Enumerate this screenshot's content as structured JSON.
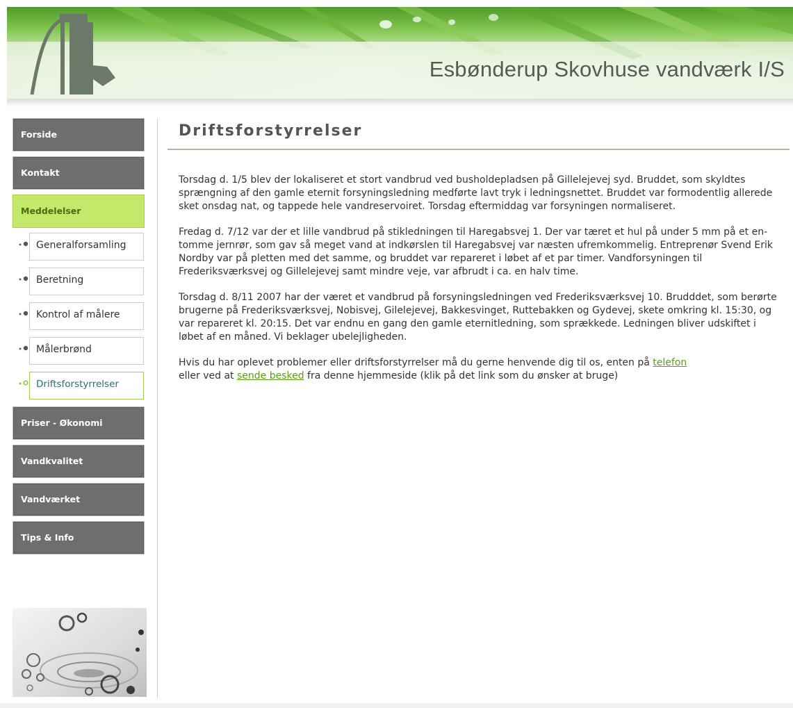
{
  "header": {
    "site_title": "Esbønderup Skovhuse vandværk I/S",
    "logo_icon": "water-pump-icon"
  },
  "nav": {
    "items_top": [
      {
        "label": "Forside"
      },
      {
        "label": "Kontakt"
      },
      {
        "label": "Meddelelser",
        "active": true
      }
    ],
    "sub_items": [
      {
        "label": "Generalforsamling"
      },
      {
        "label": "Beretning"
      },
      {
        "label": "Kontrol af målere"
      },
      {
        "label": "Målerbrønd"
      },
      {
        "label": "Driftsforstyrrelser",
        "current": true
      }
    ],
    "items_bottom": [
      {
        "label": "Priser - Økonomi"
      },
      {
        "label": "Vandkvalitet"
      },
      {
        "label": "Vandværket"
      },
      {
        "label": "Tips & Info"
      }
    ]
  },
  "main": {
    "title": "Driftsforstyrrelser",
    "paragraphs": [
      "Torsdag d. 1/5 blev der lokaliseret et stort vandbrud ved busholdepladsen på Gillelejevej syd. Bruddet, som skyldtes sprængning af den gamle eternit forsyningsledning medførte lavt tryk i ledningsnettet. Bruddet var formodentlig allerede sket onsdag nat, og tappede hele vandreservoiret. Torsdag eftermiddag var forsyningen normaliseret.",
      "Fredag d. 7/12 var der et lille vandbrud på stikledningen til Haregabsvej 1. Der var tæret et hul på under 5 mm på et en-tomme jernrør, som gav så meget vand at indkørslen til Haregabsvej var næsten ufremkommelig. Entreprenør Svend Erik Nordby var på pletten med det samme, og bruddet var repareret i løbet af et par timer. Vandforsyningen til Frederiksværksvej og Gillelejevej samt mindre veje, var afbrudt i ca. en halv time.",
      "Torsdag d. 8/11 2007 har der været et vandbrud på forsyningsledningen ved Frederiksværksvej 10. Brudddet, som berørte brugerne på Frederiksværksvej, Nobisvej, Gilelejevej, Bakkesvinget, Ruttebakken og Gydevej, skete omkring kl. 15:30, og var repareret kl. 20:15. Det var endnu en gang den gamle eternitledning, som sprækkede. Ledningen bliver udskiftet i løbet af en måned. Vi beklager ubelejligheden."
    ],
    "contact": {
      "part1": "Hvis du har oplevet problemer eller driftsforstyrrelser må du gerne henvende dig til os, enten på ",
      "link1": "telefon",
      "part2": " eller ved at ",
      "link2": "sende besked",
      "part3": " fra denne hjemmeside (klik på det link som du ønsker at bruge)"
    }
  },
  "sidebar_image": {
    "icon": "water-drops-image"
  },
  "colors": {
    "nav_bg": "#6e6e6e",
    "nav_active_bg": "#c6e86a",
    "link": "#5a9e12",
    "title_rule": "#b7b39c"
  }
}
